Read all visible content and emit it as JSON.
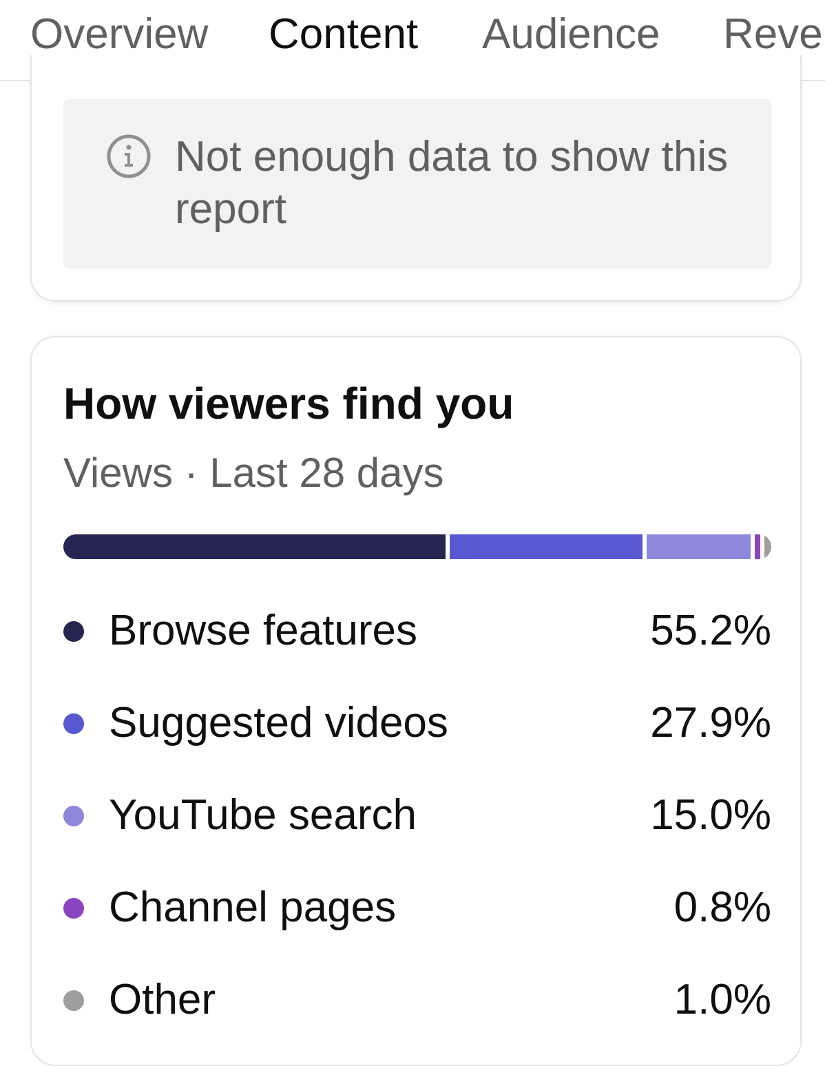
{
  "tabs": [
    {
      "label": "Overview",
      "active": false
    },
    {
      "label": "Content",
      "active": true
    },
    {
      "label": "Audience",
      "active": false
    },
    {
      "label": "Reve",
      "active": false
    }
  ],
  "notice": {
    "icon": "info-icon",
    "text": "Not enough data to show this report"
  },
  "traffic_card": {
    "title": "How viewers find you",
    "subtitle": "Views · Last 28 days"
  },
  "chart_data": {
    "type": "bar",
    "orientation": "horizontal-stacked",
    "categories": [
      "Browse features",
      "Suggested videos",
      "YouTube search",
      "Channel pages",
      "Other"
    ],
    "values": [
      55.2,
      27.9,
      15.0,
      0.8,
      1.0
    ],
    "value_labels": [
      "55.2%",
      "27.9%",
      "15.0%",
      "0.8%",
      "1.0%"
    ],
    "colors": [
      "#252552",
      "#5858d0",
      "#8c88db",
      "#8b44c0",
      "#9e9e9e"
    ],
    "unit": "%"
  }
}
